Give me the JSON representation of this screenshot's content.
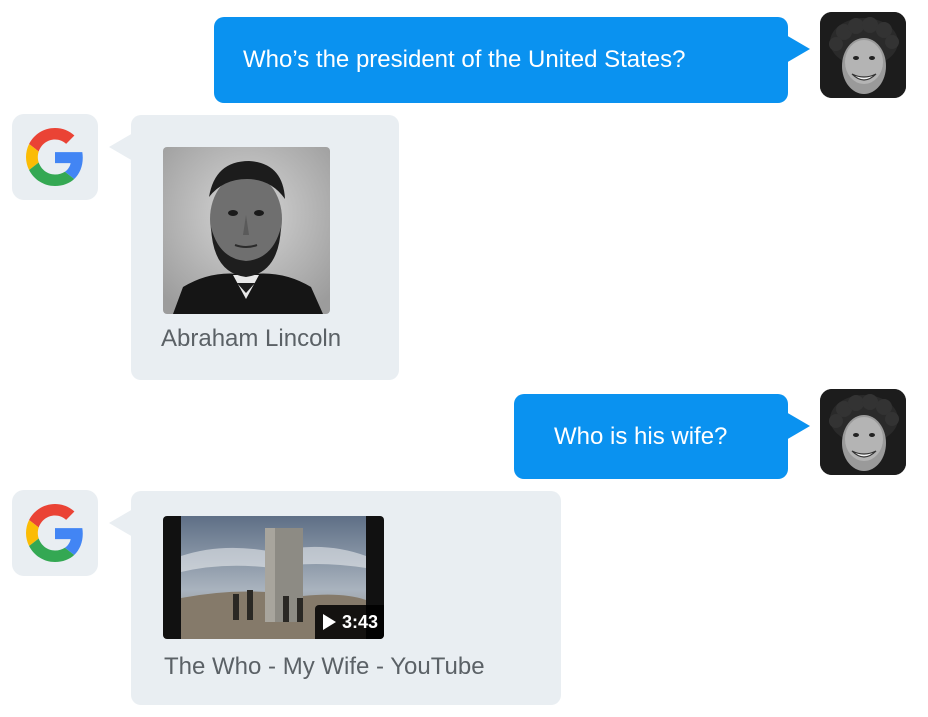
{
  "conversation": {
    "messages": [
      {
        "sender": "user",
        "text": "Who’s the president of the United States?"
      },
      {
        "sender": "assistant",
        "type": "image-card",
        "caption": "Abraham Lincoln"
      },
      {
        "sender": "user",
        "text": "Who is his wife?"
      },
      {
        "sender": "assistant",
        "type": "video-card",
        "caption": "The Who - My Wife - YouTube",
        "duration": "3:43"
      }
    ]
  },
  "icons": {
    "assistant_avatar": "google-g-icon",
    "user_avatar": "user-photo-avatar",
    "video_play": "play-icon"
  },
  "colors": {
    "user_bubble": "#0a92f0",
    "assistant_bubble": "#e9eef2",
    "caption_text": "#5b6166"
  }
}
